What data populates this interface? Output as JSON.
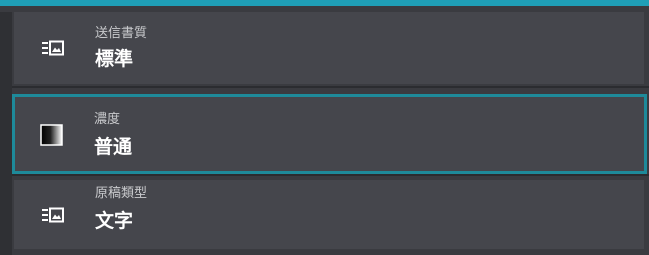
{
  "settings": {
    "items": [
      {
        "label": "送信書質",
        "value": "標準",
        "icon": "list-image-icon"
      },
      {
        "label": "濃度",
        "value": "普通",
        "icon": "density-gradient-icon"
      },
      {
        "label": "原稿類型",
        "value": "文字",
        "icon": "list-image-icon"
      }
    ]
  },
  "colors": {
    "accent": "#1f9fb7",
    "selected_border": "#1e8a9a",
    "background": "#3a3b40",
    "item_background": "#45464c"
  }
}
